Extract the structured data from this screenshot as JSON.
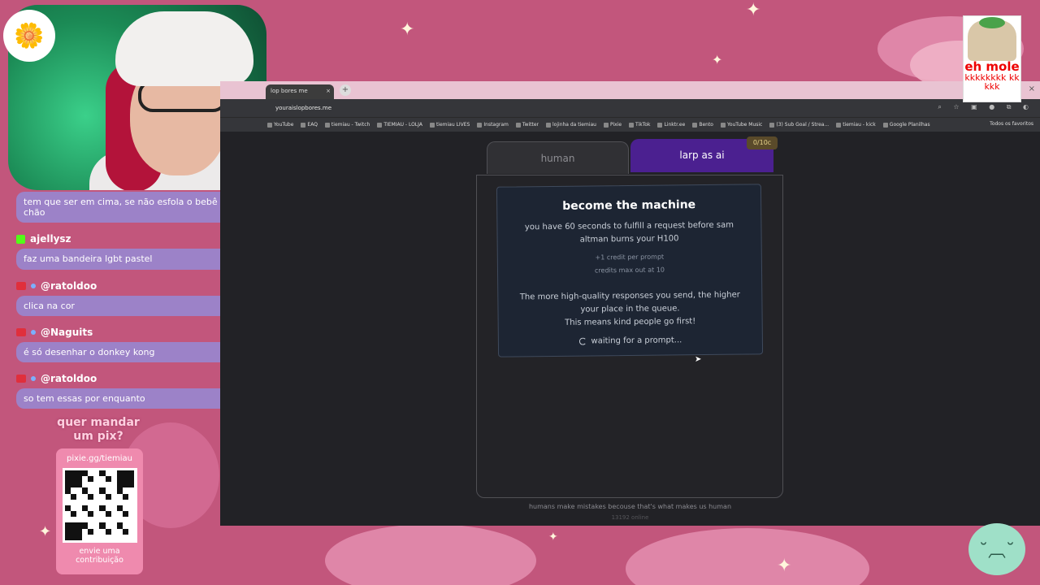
{
  "browser": {
    "tab_title": "lop bores me",
    "tab_close": "×",
    "new_tab": "+",
    "window_close": "×",
    "url": "youraislopbores.me",
    "bookmarks": [
      "YouTube",
      "EAQ",
      "tiemiau - Twitch",
      "TIEMIAU - LOLJA",
      "tiemiau LIVES",
      "Instagram",
      "Twitter",
      "lojinha da tiemiau",
      "Pixie",
      "TikTok",
      "Linktr.ee",
      "Bento",
      "YouTube Music",
      "(3) Sub Goal / Strea...",
      "tiemiau - kick",
      "Google Planilhas"
    ],
    "all_bookmarks": "Todos os favoritos"
  },
  "app": {
    "tab_human": "human",
    "tab_larp": "larp as ai",
    "credits": "0/10c",
    "card": {
      "title": "become the machine",
      "desc": "you have 60 seconds to fulfill a request before sam altman burns your H100",
      "credit_note": "+1 credit per prompt",
      "credit_max": "credits max out at 10",
      "queue_note": "The more high-quality responses you send, the higher your place in the queue.",
      "kind_note": "This means kind people go first!",
      "waiting": "waiting for a prompt..."
    },
    "footer_note": "humans make mistakes becouse that's what makes us human",
    "online": "13192 online"
  },
  "chat": {
    "messages": [
      {
        "user": "",
        "text": "tem que ser em cima, se não esfola o bebê no chão"
      },
      {
        "user": "ajellysz",
        "text": "faz uma bandeira lgbt pastel"
      },
      {
        "user": "@ratoldoo",
        "text": "clica na cor"
      },
      {
        "user": "@Naguits",
        "text": "é só desenhar o donkey kong"
      },
      {
        "user": "@ratoldoo",
        "text": "so tem essas por enquanto"
      }
    ]
  },
  "pix": {
    "title": "quer mandar um pix?",
    "url": "pixie.gg/tiemiau",
    "cta": "envie uma contribuição"
  },
  "meme": {
    "caption1": "eh mole",
    "caption2": "kkkkkkkk kkkkk"
  }
}
